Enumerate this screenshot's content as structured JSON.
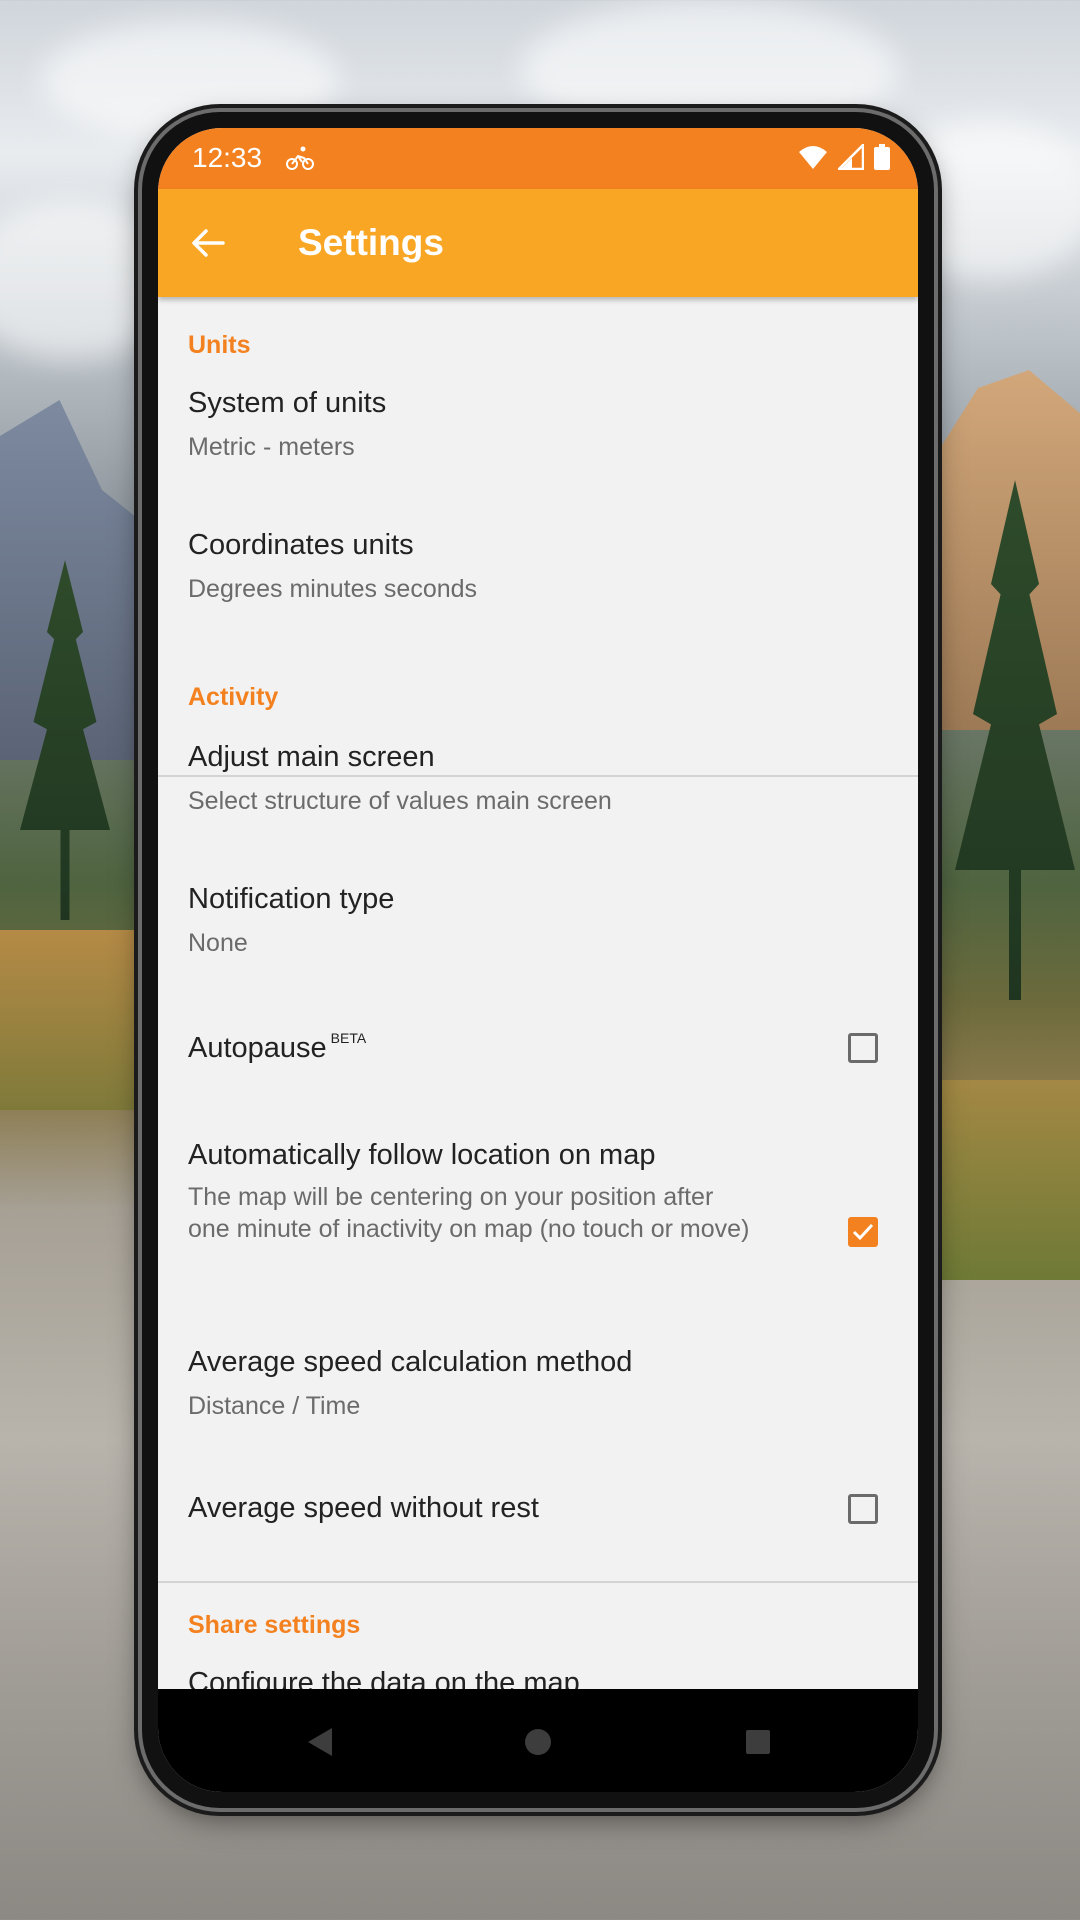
{
  "status_bar": {
    "time": "12:33"
  },
  "app_bar": {
    "title": "Settings"
  },
  "sections": {
    "units": {
      "header": "Units",
      "items": [
        {
          "title": "System of units",
          "summary": "Metric - meters"
        },
        {
          "title": "Coordinates units",
          "summary": "Degrees minutes seconds"
        }
      ]
    },
    "activity": {
      "header": "Activity",
      "items": [
        {
          "title": "Adjust main screen",
          "summary": "Select structure of values main screen"
        },
        {
          "title": "Notification type",
          "summary": "None"
        },
        {
          "title": "Autopause",
          "badge": "BETA",
          "checked": false
        },
        {
          "title": "Automatically follow location on map",
          "summary": "The map will be centering on your position after one minute of inactivity on map (no touch or move)",
          "checked": true
        },
        {
          "title": "Average speed calculation method",
          "summary": "Distance / Time"
        },
        {
          "title": "Average speed without rest",
          "checked": false
        }
      ]
    },
    "share": {
      "header": "Share settings",
      "items": [
        {
          "title": "Configure the data on the map"
        }
      ]
    }
  },
  "colors": {
    "status_bar": "#f4811f",
    "app_bar": "#f9a625",
    "accent": "#f4811f",
    "background": "#f2f2f2"
  },
  "icons": [
    "back-arrow-icon",
    "cyclist-icon",
    "wifi-icon",
    "cell-signal-icon",
    "battery-icon",
    "nav-back-icon",
    "nav-home-icon",
    "nav-recents-icon"
  ]
}
